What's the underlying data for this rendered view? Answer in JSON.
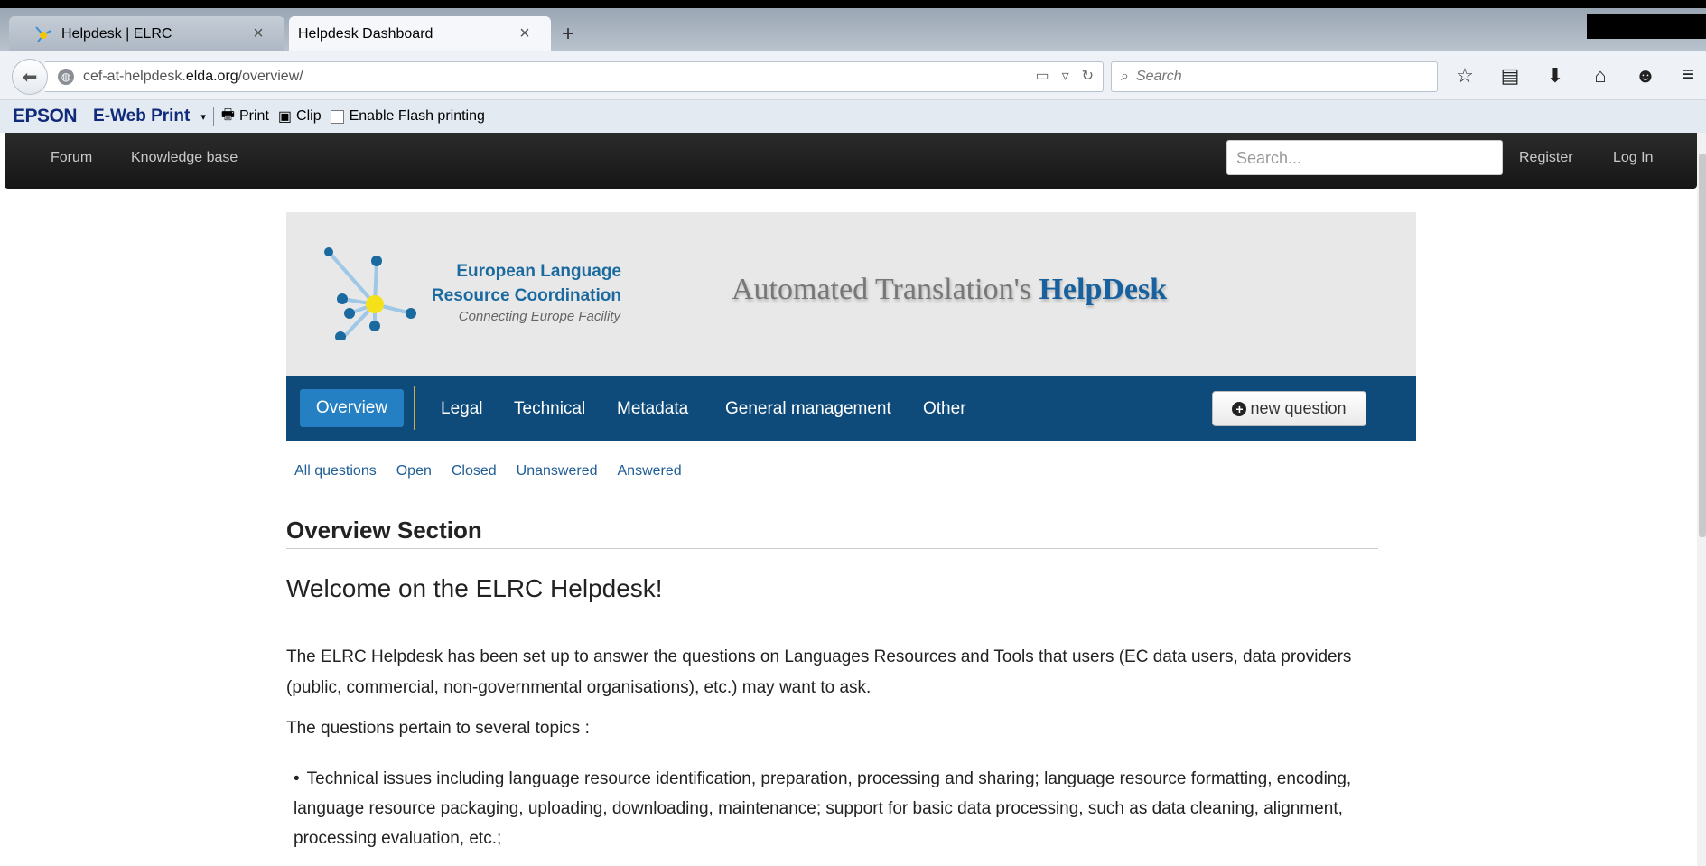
{
  "browser": {
    "tabs": [
      {
        "title": "Helpdesk | ELRC",
        "active": false
      },
      {
        "title": "Helpdesk Dashboard",
        "active": true
      }
    ],
    "new_tab_glyph": "+",
    "close_glyph": "×",
    "url_prefix": "cef-at-helpdesk.",
    "url_domain": "elda.org",
    "url_path": "/overview/",
    "search_placeholder": "Search",
    "toolbar_icons": [
      "bookmark-star-icon",
      "reading-list-icon",
      "download-icon",
      "home-icon",
      "chat-icon",
      "menu-icon"
    ]
  },
  "epson_bar": {
    "brand": "EPSON",
    "product": "E-Web Print",
    "print_label": "Print",
    "clip_label": "Clip",
    "flash_label": "Enable Flash printing"
  },
  "site_nav": {
    "forum": "Forum",
    "knowledge_base": "Knowledge base",
    "search_placeholder": "Search...",
    "register": "Register",
    "login": "Log In"
  },
  "banner": {
    "org_line1": "European Language",
    "org_line2": "Resource Coordination",
    "tagline": "Connecting Europe Facility",
    "title_prefix": "Automated Translation's ",
    "title_emphasis": "HelpDesk"
  },
  "helpdesk_nav": {
    "items": [
      "Overview",
      "Legal",
      "Technical",
      "Metadata",
      "General management",
      "Other"
    ],
    "active": "Overview",
    "new_question": "new question"
  },
  "filters": [
    "All questions",
    "Open",
    "Closed",
    "Unanswered",
    "Answered"
  ],
  "content": {
    "section_title": "Overview Section",
    "welcome": "Welcome on the ELRC Helpdesk!",
    "intro": "The ELRC Helpdesk has been set up to answer the questions on Languages Resources and Tools that users (EC data users, data providers (public, commercial, non-governmental organisations), etc.) may want to ask.",
    "topics_lead": "The questions pertain to several topics :",
    "bullets": [
      "Technical issues including language resource identification, preparation, processing and sharing; language resource formatting, encoding, language resource packaging, uploading, downloading, maintenance; support for basic data processing, such as data cleaning, alignment, processing evaluation, etc.;"
    ]
  },
  "colors": {
    "helpnav_bg": "#0e4a7a",
    "helpnav_active": "#2580c3",
    "link": "#1f5d95",
    "brand_blue": "#18619e",
    "logo_yellow": "#f5e11a"
  }
}
